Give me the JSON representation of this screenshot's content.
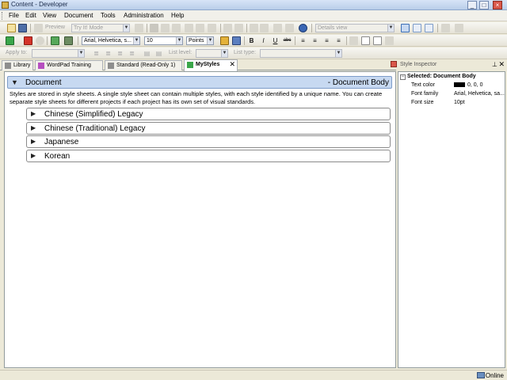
{
  "window": {
    "title": "Content - Developer",
    "controls": [
      "minimize",
      "maximize",
      "close"
    ]
  },
  "menu": [
    "File",
    "Edit",
    "View",
    "Document",
    "Tools",
    "Administration",
    "Help"
  ],
  "toolbar1": {
    "preview_label": "Preview",
    "mode_combo": "Try It! Mode",
    "view_combo": "Details view"
  },
  "toolbar2": {
    "font_combo": "Arial, Helvetica, s...",
    "size_combo": "10",
    "unit_combo": "Points",
    "bold": "B",
    "italic": "I",
    "underline": "U",
    "strike": "abc"
  },
  "toolbar3": {
    "apply_to": "Apply to:",
    "list_level": "List level:",
    "list_type": "List type:"
  },
  "tabs": [
    {
      "label": "Library"
    },
    {
      "label": "WordPad Training"
    },
    {
      "label": "Standard (Read-Only 1)"
    },
    {
      "label": "MyStyles",
      "active": true
    }
  ],
  "document": {
    "header_label": "Document",
    "header_right": "- Document Body",
    "description": "Styles are stored in style sheets. A single style sheet can contain multiple styles, with each style identified by a unique name. You can create separate style sheets for different projects if each project has its own set of visual standards.",
    "sections": [
      {
        "label": "Chinese (Simplified) Legacy"
      },
      {
        "label": "Chinese (Traditional) Legacy"
      },
      {
        "label": "Japanese"
      },
      {
        "label": "Korean"
      }
    ]
  },
  "inspector": {
    "title": "Style Inspector",
    "selected": "Selected: Document Body",
    "text_color_label": "Text color",
    "text_color_value": "0, 0, 0",
    "font_family_label": "Font family",
    "font_family_value": "Arial, Helvetica, sa...",
    "font_size_label": "Font size",
    "font_size_value": "10pt"
  },
  "status": {
    "online": "Online"
  }
}
